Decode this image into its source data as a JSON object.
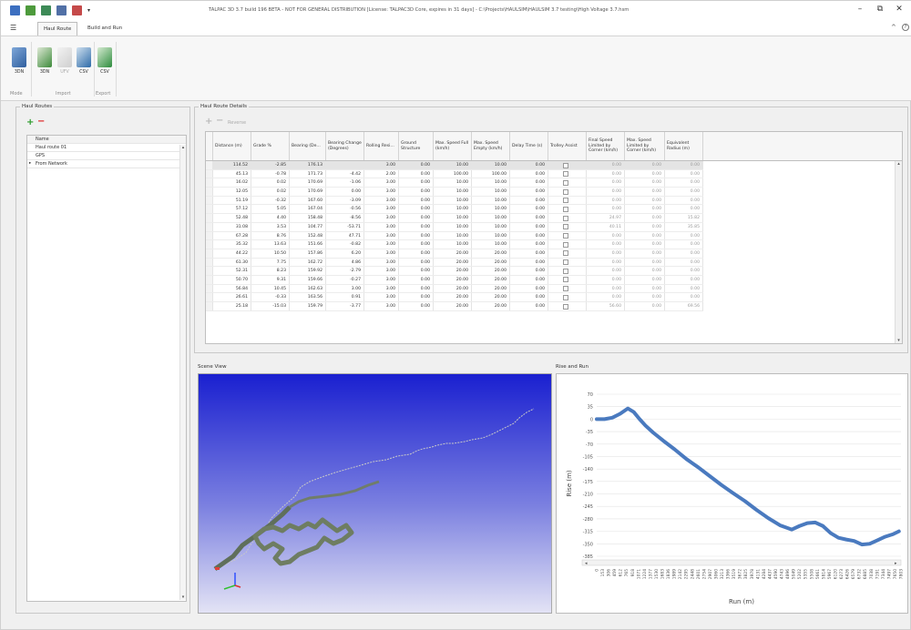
{
  "window": {
    "title": "TALPAC 3D 3.7 build 196 BETA - NOT FOR GENERAL DISTRIBUTION [License: TALPAC3D Core, expires in 31 days] - C:\\Projects\\HAULSIM\\HAULSIM 3.7 testing\\High Voltage 3.7.hsm",
    "controls": {
      "minimize": "–",
      "restore": "⧉",
      "close": "✕"
    }
  },
  "ribbon": {
    "tabs": [
      "Haul Route",
      "Build and Run"
    ],
    "active_tab": "Haul Route",
    "collapse": "^",
    "help": "?",
    "buttons": [
      {
        "label": "3DN",
        "icon": "mode-3d-icon",
        "group": "Mode",
        "enabled": true
      },
      {
        "label": "3DN",
        "icon": "import-3dn-icon",
        "group": "Import",
        "enabled": true
      },
      {
        "label": "UFV",
        "icon": "import-ufv-icon",
        "group": "Import",
        "enabled": false
      },
      {
        "label": "CSV",
        "icon": "import-csv-icon",
        "group": "Import",
        "enabled": true
      },
      {
        "label": "CSV",
        "icon": "export-csv-icon",
        "group": "Export",
        "enabled": true
      }
    ],
    "groups": [
      "Mode",
      "Import",
      "Export"
    ]
  },
  "haul_routes": {
    "title": "Haul Routes",
    "add": "+",
    "remove": "−",
    "column": "Name",
    "items": [
      "Haul route 01",
      "GPS",
      "From Network"
    ]
  },
  "details": {
    "title": "Haul Route Details",
    "reverse_label": "Reverse",
    "columns": [
      "Distance (m)",
      "Grade %",
      "Bearing (De...",
      "Bearing Change (Degrees)",
      "Rolling Resi...",
      "Ground Structure",
      "Max. Speed Full (km/h)",
      "Max. Speed Empty (km/h)",
      "Delay Time (s)",
      "Trolley Assist",
      "Final Speed Limited by Corner (km/h)",
      "Max. Speed Limited by Corner (km/h)",
      "Equivalent Radius (m)"
    ],
    "rows": [
      [
        "114.52",
        "-2.85",
        "176.13",
        "",
        "3.00",
        "0.00",
        "10.00",
        "10.00",
        "0.00",
        "",
        "0.00",
        "0.00",
        "0.00"
      ],
      [
        "45.13",
        "-0.78",
        "171.73",
        "-4.42",
        "2.00",
        "0.00",
        "100.00",
        "100.00",
        "0.00",
        "",
        "0.00",
        "0.00",
        "0.00"
      ],
      [
        "16.02",
        "0.02",
        "170.69",
        "-1.06",
        "3.00",
        "0.00",
        "10.00",
        "10.00",
        "0.00",
        "",
        "0.00",
        "0.00",
        "0.00"
      ],
      [
        "12.05",
        "0.02",
        "170.69",
        "0.00",
        "3.00",
        "0.00",
        "10.00",
        "10.00",
        "0.00",
        "",
        "0.00",
        "0.00",
        "0.00"
      ],
      [
        "51.19",
        "-0.32",
        "167.60",
        "-3.09",
        "3.00",
        "0.00",
        "10.00",
        "10.00",
        "0.00",
        "",
        "0.00",
        "0.00",
        "0.00"
      ],
      [
        "57.12",
        "5.05",
        "167.04",
        "-0.56",
        "3.00",
        "0.00",
        "10.00",
        "10.00",
        "0.00",
        "",
        "0.00",
        "0.00",
        "0.00"
      ],
      [
        "52.48",
        "4.40",
        "158.48",
        "-8.56",
        "3.00",
        "0.00",
        "10.00",
        "10.00",
        "0.00",
        "",
        "24.97",
        "0.00",
        "15.82"
      ],
      [
        "31.08",
        "3.53",
        "104.77",
        "-53.71",
        "3.00",
        "0.00",
        "10.00",
        "10.00",
        "0.00",
        "",
        "40.11",
        "0.00",
        "35.85"
      ],
      [
        "67.28",
        "8.76",
        "152.48",
        "47.71",
        "3.00",
        "0.00",
        "10.00",
        "10.00",
        "0.00",
        "",
        "0.00",
        "0.00",
        "0.00"
      ],
      [
        "35.32",
        "13.63",
        "151.66",
        "-0.82",
        "3.00",
        "0.00",
        "10.00",
        "10.00",
        "0.00",
        "",
        "0.00",
        "0.00",
        "0.00"
      ],
      [
        "44.22",
        "10.50",
        "157.86",
        "6.20",
        "3.00",
        "0.00",
        "20.00",
        "20.00",
        "0.00",
        "",
        "0.00",
        "0.00",
        "0.00"
      ],
      [
        "61.30",
        "7.75",
        "162.72",
        "4.86",
        "3.00",
        "0.00",
        "20.00",
        "20.00",
        "0.00",
        "",
        "0.00",
        "0.00",
        "0.00"
      ],
      [
        "52.31",
        "8.23",
        "159.92",
        "-2.79",
        "3.00",
        "0.00",
        "20.00",
        "20.00",
        "0.00",
        "",
        "0.00",
        "0.00",
        "0.00"
      ],
      [
        "50.70",
        "9.31",
        "159.66",
        "-0.27",
        "3.00",
        "0.00",
        "20.00",
        "20.00",
        "0.00",
        "",
        "0.00",
        "0.00",
        "0.00"
      ],
      [
        "56.84",
        "10.45",
        "162.63",
        "3.00",
        "3.00",
        "0.00",
        "20.00",
        "20.00",
        "0.00",
        "",
        "0.00",
        "0.00",
        "0.00"
      ],
      [
        "26.61",
        "-0.33",
        "163.56",
        "0.91",
        "3.00",
        "0.00",
        "20.00",
        "20.00",
        "0.00",
        "",
        "0.00",
        "0.00",
        "0.00"
      ],
      [
        "25.18",
        "-15.03",
        "159.79",
        "-3.77",
        "3.00",
        "0.00",
        "20.00",
        "20.00",
        "0.00",
        "",
        "56.60",
        "0.00",
        "69.56"
      ]
    ]
  },
  "scene": {
    "title": "Scene View"
  },
  "rise_run": {
    "title": "Rise and Run"
  },
  "chart_data": {
    "type": "line",
    "title": "",
    "xlabel": "Run (m)",
    "ylabel": "Rise (m)",
    "yticks": [
      70,
      35,
      0,
      -35,
      -70,
      -105,
      -140,
      -175,
      -210,
      -245,
      -280,
      -315,
      -350,
      -385
    ],
    "xticks": [
      0,
      153,
      306,
      459,
      612,
      765,
      918,
      1071,
      1224,
      1377,
      1530,
      1683,
      1836,
      1989,
      2142,
      2295,
      2448,
      2601,
      2754,
      2907,
      3060,
      3213,
      3366,
      3519,
      3672,
      3825,
      3978,
      4131,
      4284,
      4437,
      4590,
      4743,
      4896,
      5049,
      5202,
      5355,
      5508,
      5661,
      5814,
      5967,
      6120,
      6273,
      6426,
      6579,
      6732,
      6885,
      7038,
      7191,
      7344,
      7497,
      7650,
      7803
    ],
    "xlim": [
      0,
      7803
    ],
    "ylim": [
      -385,
      70
    ],
    "grid": true,
    "series": [
      {
        "color": "#4a7abf",
        "x": [
          0,
          200,
          400,
          600,
          800,
          950,
          1100,
          1250,
          1450,
          1700,
          2000,
          2300,
          2600,
          2900,
          3200,
          3500,
          3800,
          4100,
          4400,
          4700,
          5000,
          5200,
          5400,
          5600,
          5800,
          6000,
          6200,
          6400,
          6600,
          6800,
          7000,
          7200,
          7400,
          7600,
          7750
        ],
        "y": [
          0,
          0,
          4,
          15,
          30,
          20,
          0,
          -18,
          -38,
          -60,
          -85,
          -112,
          -135,
          -160,
          -185,
          -208,
          -230,
          -255,
          -278,
          -298,
          -310,
          -300,
          -292,
          -290,
          -300,
          -320,
          -333,
          -338,
          -342,
          -352,
          -350,
          -340,
          -330,
          -323,
          -315
        ]
      }
    ]
  }
}
